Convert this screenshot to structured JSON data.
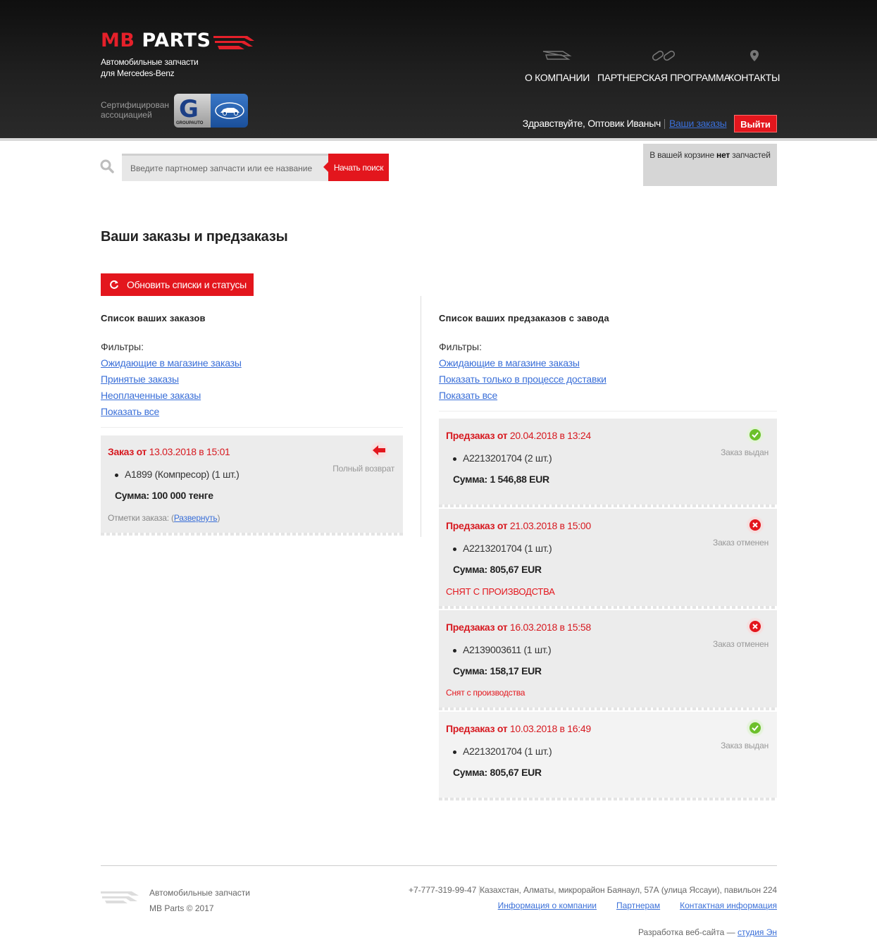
{
  "header": {
    "logo_mb": "MB",
    "logo_parts": "PARTS",
    "tagline_line1": "Автомобильные запчасти",
    "tagline_line2": "для Mercedes-Benz",
    "cert_line1": "Сертифицирован",
    "cert_line2": "ассоциацией",
    "cert_badge_text": "GROUPAUTO",
    "nav": {
      "about": "О КОМПАНИИ",
      "partner": "ПАРТНЕРСКАЯ ПРОГРАММА",
      "contacts": "КОНТАКТЫ"
    },
    "greeting": "Здравствуйте, Оптовик Иваныч",
    "orders_link": "Ваши заказы",
    "logout": "Выйти"
  },
  "search": {
    "placeholder": "Введите партномер запчасти или ее название",
    "button": "Начать поиск"
  },
  "cart": {
    "prefix": "В вашей корзине ",
    "bold": "нет",
    "suffix": " запчастей"
  },
  "page": {
    "title": "Ваши заказы и предзаказы",
    "refresh": "Обновить списки и статусы"
  },
  "orders": {
    "title": "Список ваших заказов",
    "filters_label": "Фильтры:",
    "filters": [
      "Ожидающие в магазине заказы",
      "Принятые заказы",
      "Неоплаченные заказы",
      "Показать все"
    ],
    "items": [
      {
        "title_prefix": "Заказ от ",
        "date": "13.03.2018 в 15:01",
        "line": "A1899 (Компресор) (1 шт.)",
        "sum": "Сумма: 100 000 тенге",
        "status": "Полный возврат",
        "marks_label": "Отметки заказа: (",
        "marks_link": "Развернуть",
        "marks_close": ")"
      }
    ]
  },
  "preorders": {
    "title": "Список ваших предзаказов с завода",
    "filters_label": "Фильтры:",
    "filters": [
      "Ожидающие в магазине заказы",
      "Показать только в процессе доставки",
      "Показать все"
    ],
    "items": [
      {
        "title_prefix": "Предзаказ от ",
        "date": "20.04.2018 в 13:24",
        "line": "A2213201704 (2 шт.)",
        "sum": "Сумма: 1 546,88 EUR",
        "status": "Заказ выдан",
        "status_type": "ok",
        "note": ""
      },
      {
        "title_prefix": "Предзаказ от ",
        "date": "21.03.2018 в 15:00",
        "line": "A2213201704 (1 шт.)",
        "sum": "Сумма: 805,67 EUR",
        "status": "Заказ отменен",
        "status_type": "cancel",
        "note": "СНЯТ С ПРОИЗВОДСТВА"
      },
      {
        "title_prefix": "Предзаказ от ",
        "date": "16.03.2018 в 15:58",
        "line": "A2139003611 (1 шт.)",
        "sum": "Сумма: 158,17 EUR",
        "status": "Заказ отменен",
        "status_type": "cancel",
        "note": "Снят с производства"
      },
      {
        "title_prefix": "Предзаказ от ",
        "date": "10.03.2018 в 16:49",
        "line": "A2213201704 (1 шт.)",
        "sum": "Сумма: 805,67 EUR",
        "status": "Заказ выдан",
        "status_type": "ok",
        "note": ""
      }
    ]
  },
  "footer": {
    "copy_line1": "Автомобильные запчасти",
    "copy_line2": "MB Parts © 2017",
    "phone": "+7-777-319-99-47",
    "address": "Казахстан, Алматы, микрорайон Баянаул, 57А (улица Яссауи), павильон 224",
    "links": [
      "Информация о компании",
      "Партнерам",
      "Контактная информация"
    ],
    "dev_prefix": "Разработка веб-сайта — ",
    "dev_link": "студия Эн"
  },
  "colors": {
    "accent_red": "#e3161d",
    "link_blue": "#3a6fd8",
    "ok_green": "#6cc02a"
  }
}
